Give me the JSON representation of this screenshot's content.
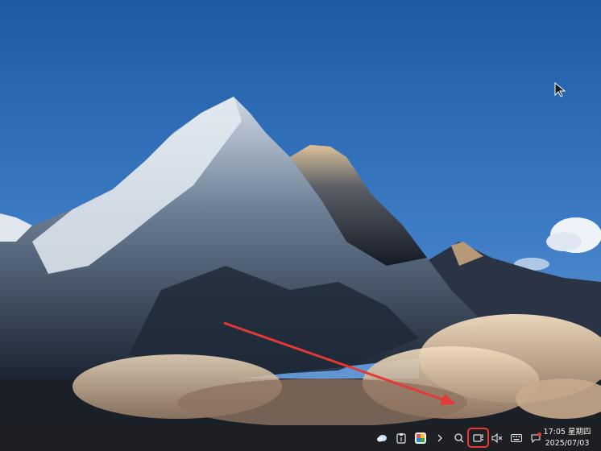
{
  "wallpaper": {
    "icon": "mountain-wallpaper"
  },
  "annotation": {
    "arrow_color": "#e53935",
    "highlight_color": "#e53935"
  },
  "taskbar": {
    "tray_icons": [
      {
        "name": "weather-cloud-icon"
      },
      {
        "name": "clipboard-icon"
      },
      {
        "name": "app-store-icon"
      },
      {
        "name": "expand-chevron-icon"
      },
      {
        "name": "search-icon"
      },
      {
        "name": "screen-record-icon",
        "highlighted": true
      },
      {
        "name": "volume-muted-icon"
      },
      {
        "name": "keyboard-icon"
      },
      {
        "name": "notification-icon"
      }
    ],
    "clock": {
      "time_day": "17:05 星期四",
      "date": "2025/07/03"
    }
  }
}
